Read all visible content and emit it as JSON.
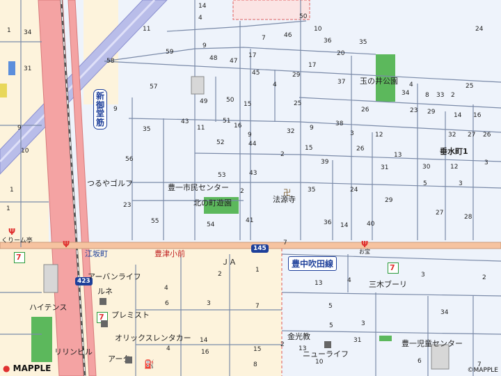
{
  "brand": "MAPPLE",
  "copyright": "©MAPPLE",
  "colors": {
    "residential_bg": "#eef3fb",
    "commercial_bg": "#fdf3dc",
    "main_road": "#f4a3a3",
    "railway": "#555555",
    "expressway": "#b9bde9",
    "park": "#5cb85c",
    "block_line": "#7a8aa8"
  },
  "roads": {
    "shin_midosuji": "新御堂筋",
    "toyonaka_suita": "豊中吹田線",
    "route_145": "145",
    "route_423": "423"
  },
  "places": {
    "tarumi": "垂水町1",
    "toyoichi_center": "豊一市民センター",
    "kitanomachi_park": "北の町遊園",
    "hogenji": "法源寺",
    "tamanoi_park": "玉の井公園",
    "tsuruya_golf": "つるやゴルフ",
    "esaka_cho": "江坂町",
    "toyotsu_crossing": "豊津小前",
    "ja": "ＪＡ",
    "urban_life": "アーバンライフ",
    "runeru": "ルネ",
    "heights": "ハイテンス",
    "premist": "プレミスト",
    "orix_rental": "オリックスレンタカー",
    "ryan_bil": "リリンビル",
    "arc": "アーク",
    "konkokyo": "金光教",
    "new_life": "ニューライフ",
    "mikiburi": "三木ブーリ",
    "toyoichi_jido": "豊一児童センター",
    "kuri_mu": "くりーム亭",
    "mon_shop": "お宝"
  },
  "block_numbers": [
    {
      "t": "14"
    },
    {
      "t": "4"
    },
    {
      "t": "50"
    },
    {
      "t": "24"
    },
    {
      "t": "1"
    },
    {
      "t": "34"
    },
    {
      "t": "11"
    },
    {
      "t": "7"
    },
    {
      "t": "46"
    },
    {
      "t": "10"
    },
    {
      "t": "36"
    },
    {
      "t": "35"
    },
    {
      "t": "20"
    },
    {
      "t": "9"
    },
    {
      "t": "59"
    },
    {
      "t": "48"
    },
    {
      "t": "47"
    },
    {
      "t": "17"
    },
    {
      "t": "31"
    },
    {
      "t": "58"
    },
    {
      "t": "45"
    },
    {
      "t": "29"
    },
    {
      "t": "17"
    },
    {
      "t": "37"
    },
    {
      "t": "4"
    },
    {
      "t": "57"
    },
    {
      "t": "4"
    },
    {
      "t": "49"
    },
    {
      "t": "50"
    },
    {
      "t": "15"
    },
    {
      "t": "25"
    },
    {
      "t": "9"
    },
    {
      "t": "34"
    },
    {
      "t": "8"
    },
    {
      "t": "33"
    },
    {
      "t": "2"
    },
    {
      "t": "25"
    },
    {
      "t": "9"
    },
    {
      "t": "23"
    },
    {
      "t": "29"
    },
    {
      "t": "14"
    },
    {
      "t": "16"
    },
    {
      "t": "43"
    },
    {
      "t": "11"
    },
    {
      "t": "51"
    },
    {
      "t": "16"
    },
    {
      "t": "32"
    },
    {
      "t": "9"
    },
    {
      "t": "38"
    },
    {
      "t": "26"
    },
    {
      "t": "35"
    },
    {
      "t": "9"
    },
    {
      "t": "3"
    },
    {
      "t": "12"
    },
    {
      "t": "32"
    },
    {
      "t": "27"
    },
    {
      "t": "26"
    },
    {
      "t": "10"
    },
    {
      "t": "52"
    },
    {
      "t": "44"
    },
    {
      "t": "2"
    },
    {
      "t": "15"
    },
    {
      "t": "26"
    },
    {
      "t": "13"
    },
    {
      "t": "56"
    },
    {
      "t": "39"
    },
    {
      "t": "31"
    },
    {
      "t": "30"
    },
    {
      "t": "12"
    },
    {
      "t": "3"
    },
    {
      "t": "53"
    },
    {
      "t": "43"
    },
    {
      "t": "5"
    },
    {
      "t": "3"
    },
    {
      "t": "35"
    },
    {
      "t": "24"
    },
    {
      "t": "2"
    },
    {
      "t": "1"
    },
    {
      "t": "29"
    },
    {
      "t": "23"
    },
    {
      "t": "27"
    },
    {
      "t": "55"
    },
    {
      "t": "54"
    },
    {
      "t": "41"
    },
    {
      "t": "36"
    },
    {
      "t": "14"
    },
    {
      "t": "40"
    },
    {
      "t": "28"
    },
    {
      "t": "7"
    },
    {
      "t": "1"
    },
    {
      "t": "4"
    },
    {
      "t": "2"
    },
    {
      "t": "1"
    },
    {
      "t": "13"
    },
    {
      "t": "4"
    },
    {
      "t": "3"
    },
    {
      "t": "2"
    },
    {
      "t": "6"
    },
    {
      "t": "3"
    },
    {
      "t": "5"
    },
    {
      "t": "34"
    },
    {
      "t": "7"
    },
    {
      "t": "5"
    },
    {
      "t": "3"
    },
    {
      "t": "14"
    },
    {
      "t": "4"
    },
    {
      "t": "2"
    },
    {
      "t": "31"
    },
    {
      "t": "16"
    },
    {
      "t": "15"
    },
    {
      "t": "8"
    },
    {
      "t": "13"
    },
    {
      "t": "10"
    },
    {
      "t": "6"
    },
    {
      "t": "7"
    }
  ]
}
